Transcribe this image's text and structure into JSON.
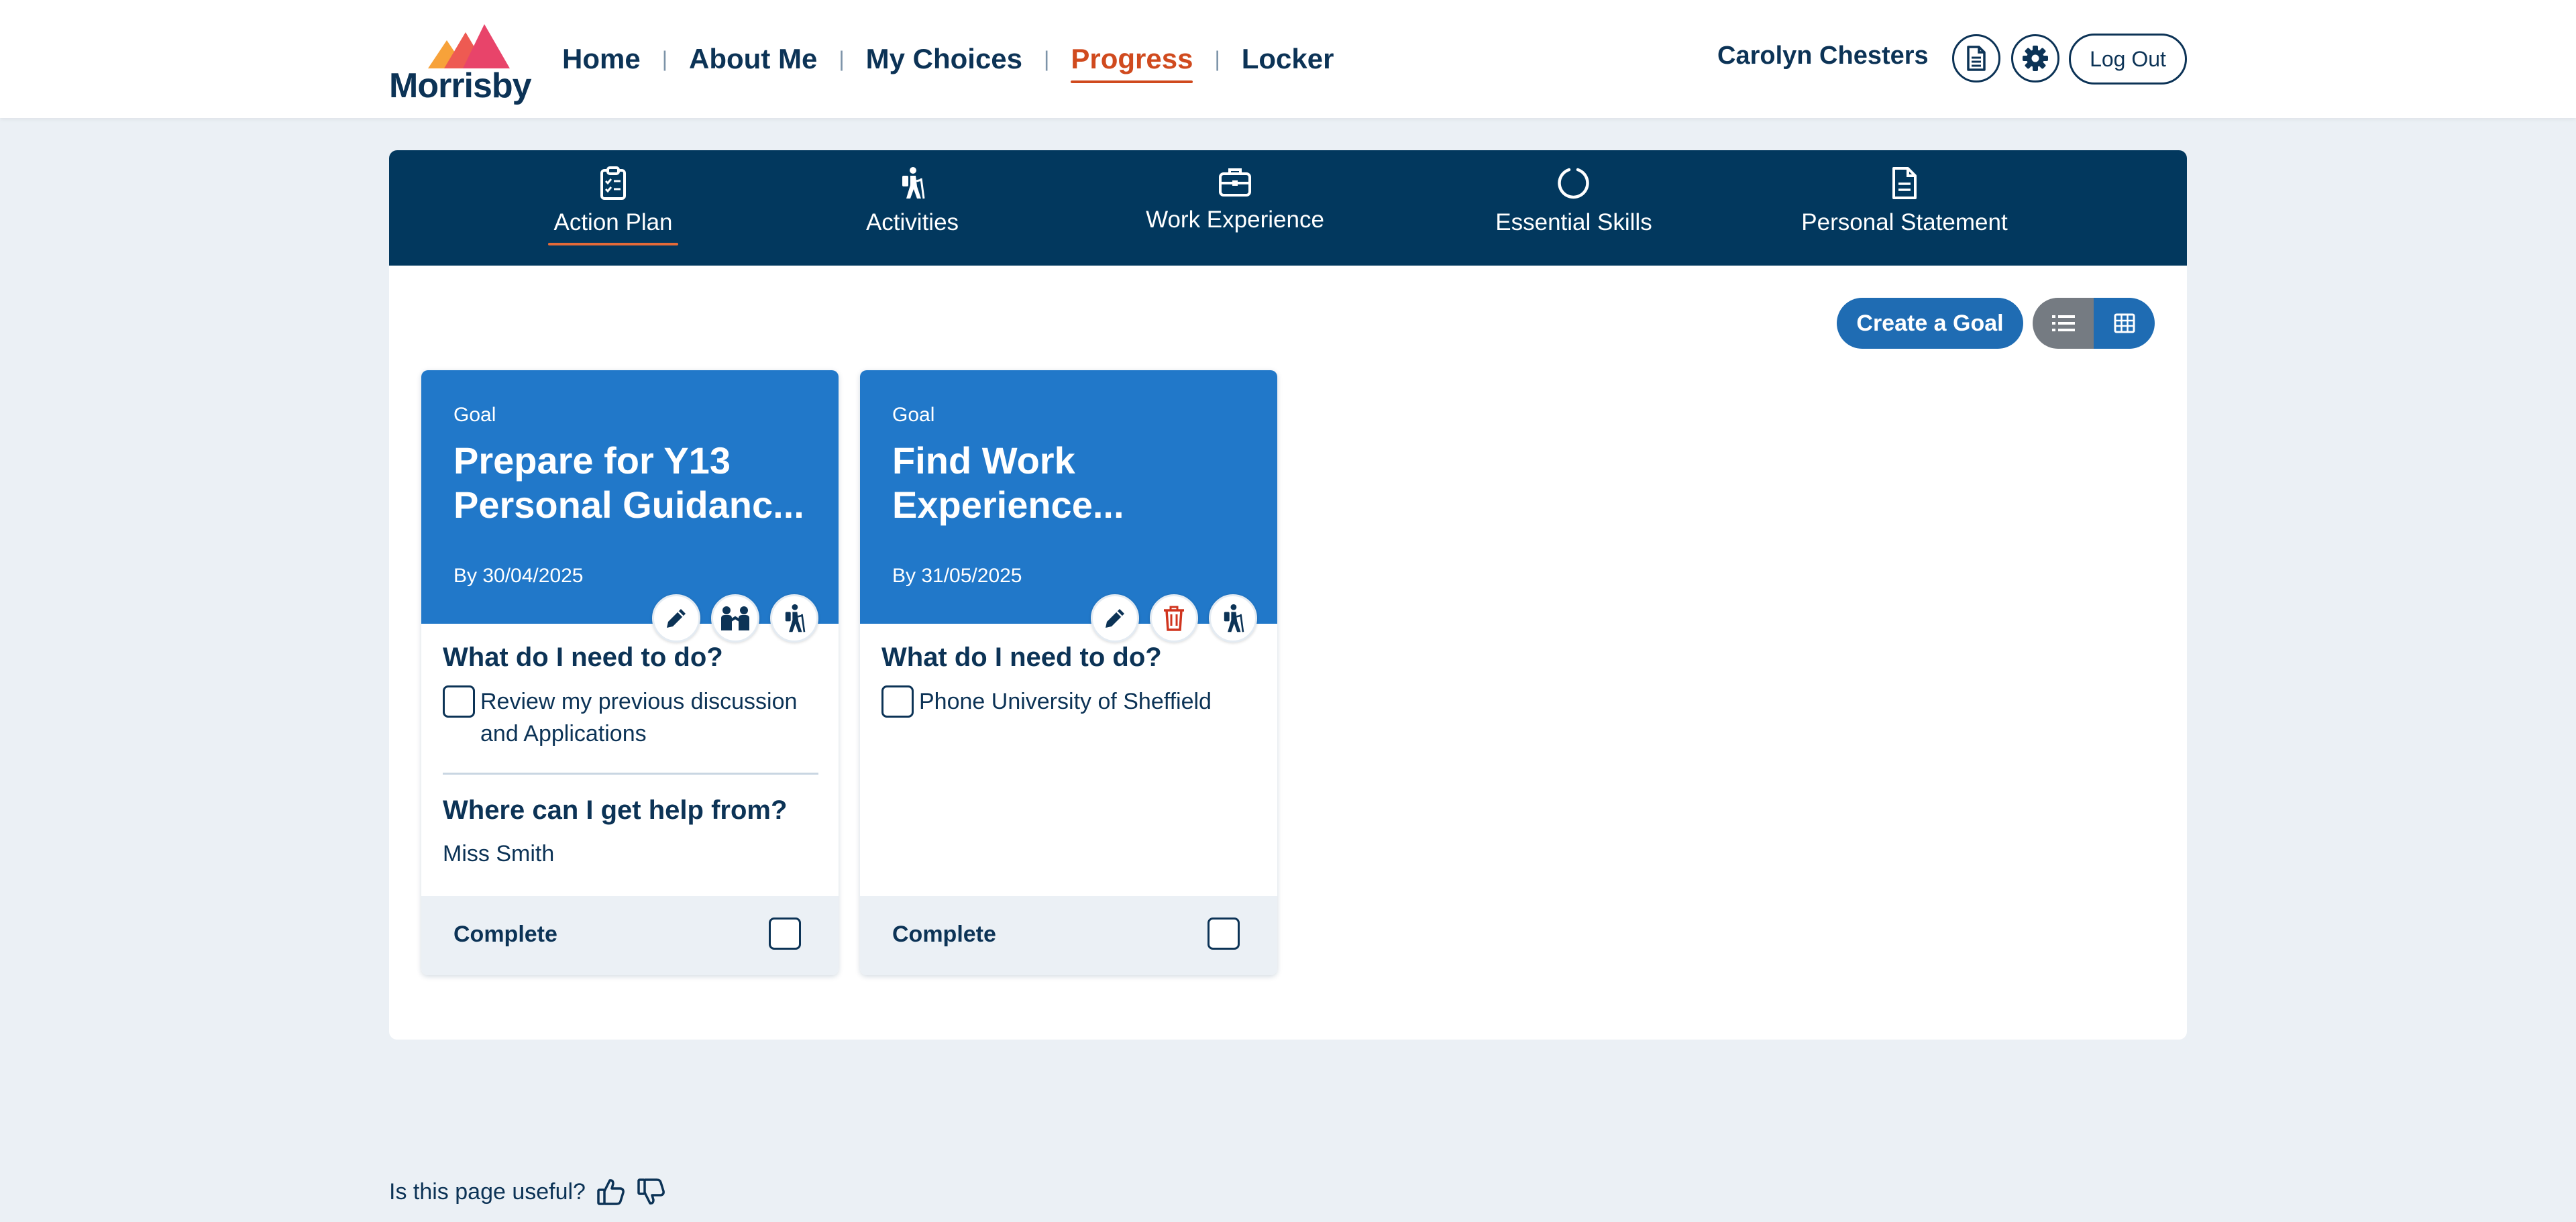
{
  "header": {
    "logo_text": "Morrisby",
    "nav": [
      {
        "label": "Home"
      },
      {
        "label": "About Me"
      },
      {
        "label": "My Choices"
      },
      {
        "label": "Progress"
      },
      {
        "label": "Locker"
      }
    ],
    "active_nav": "Progress",
    "user_name": "Carolyn Chesters",
    "logout_label": "Log Out"
  },
  "subnav": {
    "items": [
      {
        "label": "Action Plan",
        "icon": "clipboard-list-icon"
      },
      {
        "label": "Activities",
        "icon": "hiking-person-icon"
      },
      {
        "label": "Work Experience",
        "icon": "briefcase-icon"
      },
      {
        "label": "Essential Skills",
        "icon": "circle-notch-icon"
      },
      {
        "label": "Personal Statement",
        "icon": "document-icon"
      }
    ],
    "active": "Action Plan"
  },
  "toolbar": {
    "create_goal_label": "Create a Goal",
    "view_mode": "grid"
  },
  "cards": [
    {
      "kind": "Goal",
      "title": "Prepare for Y13 Personal Guidanc...",
      "date": "By 30/04/2025",
      "actions": [
        "pencil-icon",
        "people-icon",
        "hiking-person-icon"
      ],
      "need_title": "What do I need to do?",
      "tasks": [
        "Review my previous discussion and Applications"
      ],
      "help_title": "Where can I get help from?",
      "help": "Miss Smith",
      "complete_label": "Complete"
    },
    {
      "kind": "Goal",
      "title": "Find Work Experience...",
      "date": "By 31/05/2025",
      "actions": [
        "pencil-icon",
        "trash-icon",
        "hiking-person-icon"
      ],
      "need_title": "What do I need to do?",
      "tasks": [
        "Phone University of Sheffield"
      ],
      "complete_label": "Complete"
    }
  ],
  "feedback": {
    "question": "Is this page useful?"
  },
  "colors": {
    "navy": "#0c3356",
    "subnav_bg": "#02385e",
    "card_blue": "#2178c9",
    "accent_orange": "#d04a1e",
    "page_bg": "#ebf0f5",
    "delete_red": "#d0341e"
  }
}
